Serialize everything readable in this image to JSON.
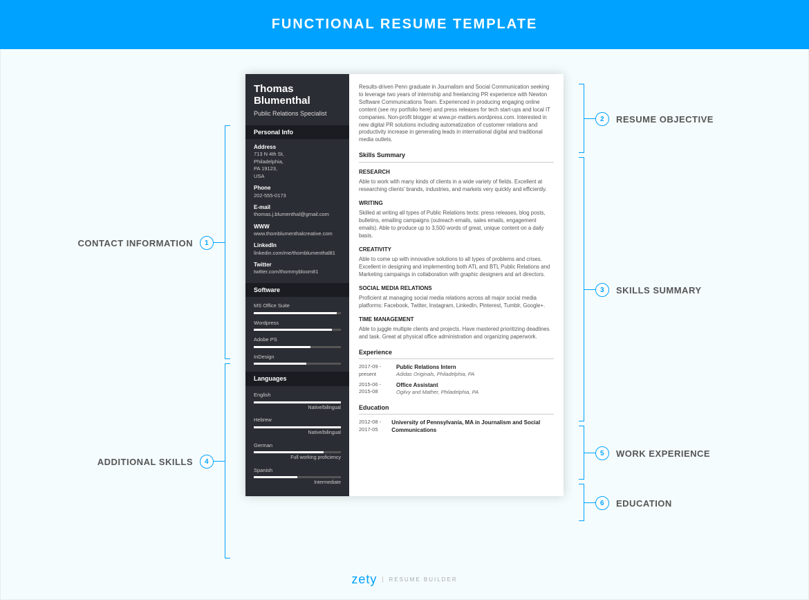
{
  "header": {
    "title": "FUNCTIONAL RESUME TEMPLATE"
  },
  "labels": {
    "left": [
      {
        "num": "1",
        "text": "CONTACT INFORMATION"
      },
      {
        "num": "4",
        "text": "ADDITIONAL SKILLS"
      }
    ],
    "right": [
      {
        "num": "2",
        "text": "RESUME OBJECTIVE"
      },
      {
        "num": "3",
        "text": "SKILLS SUMMARY"
      },
      {
        "num": "5",
        "text": "WORK EXPERIENCE"
      },
      {
        "num": "6",
        "text": "EDUCATION"
      }
    ]
  },
  "resume": {
    "name": "Thomas Blumenthal",
    "role": "Public Relations Specialist",
    "personal_info_title": "Personal Info",
    "personal": {
      "address_label": "Address",
      "address": "713 N 4th St,\nPhiladelphia,\nPA 19123,\nUSA",
      "phone_label": "Phone",
      "phone": "202-555-0173",
      "email_label": "E-mail",
      "email": "thomas.j.blumenthal@gmail.com",
      "www_label": "WWW",
      "www": "www.thomblumenthalcreative.com",
      "linkedin_label": "LinkedIn",
      "linkedin": "linkedin.com/me/thomblumenthal81",
      "twitter_label": "Twitter",
      "twitter": "twitter.com/thommybloom81"
    },
    "software_title": "Software",
    "software": [
      {
        "name": "MS Office Suite",
        "pct": 95
      },
      {
        "name": "Wordpress",
        "pct": 90
      },
      {
        "name": "Adobe PS",
        "pct": 65
      },
      {
        "name": "InDesign",
        "pct": 60
      }
    ],
    "languages_title": "Languages",
    "languages": [
      {
        "name": "English",
        "level": "Native/bilingual",
        "pct": 100
      },
      {
        "name": "Hebrew",
        "level": "Native/bilingual",
        "pct": 100
      },
      {
        "name": "German",
        "level": "Full working proficiency",
        "pct": 80
      },
      {
        "name": "Spanish",
        "level": "Intermediate",
        "pct": 50
      }
    ],
    "objective": "Results-driven Penn graduate in Journalism and Social Communication seeking to leverage two years of internship and freelancing PR experience with Newton Software Communications Team. Experienced in producing engaging online content (see my portfolio here) and press releases for tech start-ups and local IT companies. Non-profit blogger at www.pr-matters.wordpress.com. Interested in new digital PR solutions including automatization of customer relations and productivity increase in generating leads in international digital and traditional media outlets.",
    "skills_summary_title": "Skills Summary",
    "skills": [
      {
        "title": "RESEARCH",
        "text": "Able to work with many kinds of clients in a wide variety of fields. Excellent at researching clients' brands, industries, and markets very quickly and efficiently."
      },
      {
        "title": "WRITING",
        "text": "Skilled at writing all types of Public Relations texts: press releases, blog posts, bulletins, emailing campaigns (outreach emails, sales emails, engagement emails). Able to produce up to 3,500 words of great, unique content on a daily basis."
      },
      {
        "title": "CREATIVITY",
        "text": "Able to come up with innovative solutions to all types of problems and crises. Excellent in designing and implementing both ATL and BTL Public Relations and Marketing campaings in collaboration with graphic designers and art directors."
      },
      {
        "title": "SOCIAL MEDIA RELATIONS",
        "text": "Proficient at managing social media relations across all major social media platforms: Facebook, Twitter, Instagram, LinkedIn, Pinterest, Tumblr, Google+."
      },
      {
        "title": "TIME MANAGEMENT",
        "text": "Able to juggle multiple clients and projects. Have mastered prioritizing deadlines and task. Great at physical office administration and organizing paperwork."
      }
    ],
    "experience_title": "Experience",
    "experience": [
      {
        "date": "2017-09 - present",
        "position": "Public Relations Intern",
        "location": "Adidas Originals, Philadelphia, PA"
      },
      {
        "date": "2015-06 - 2015-08",
        "position": "Office Assistant",
        "location": "Ogilvy and Mather, Philadelphia, PA"
      }
    ],
    "education_title": "Education",
    "education": [
      {
        "date": "2012-08 - 2017-05",
        "degree": "University of Pennsylvania, MA in Journalism and Social Communications"
      }
    ]
  },
  "footer": {
    "brand": "zety",
    "sub": "RESUME BUILDER"
  }
}
